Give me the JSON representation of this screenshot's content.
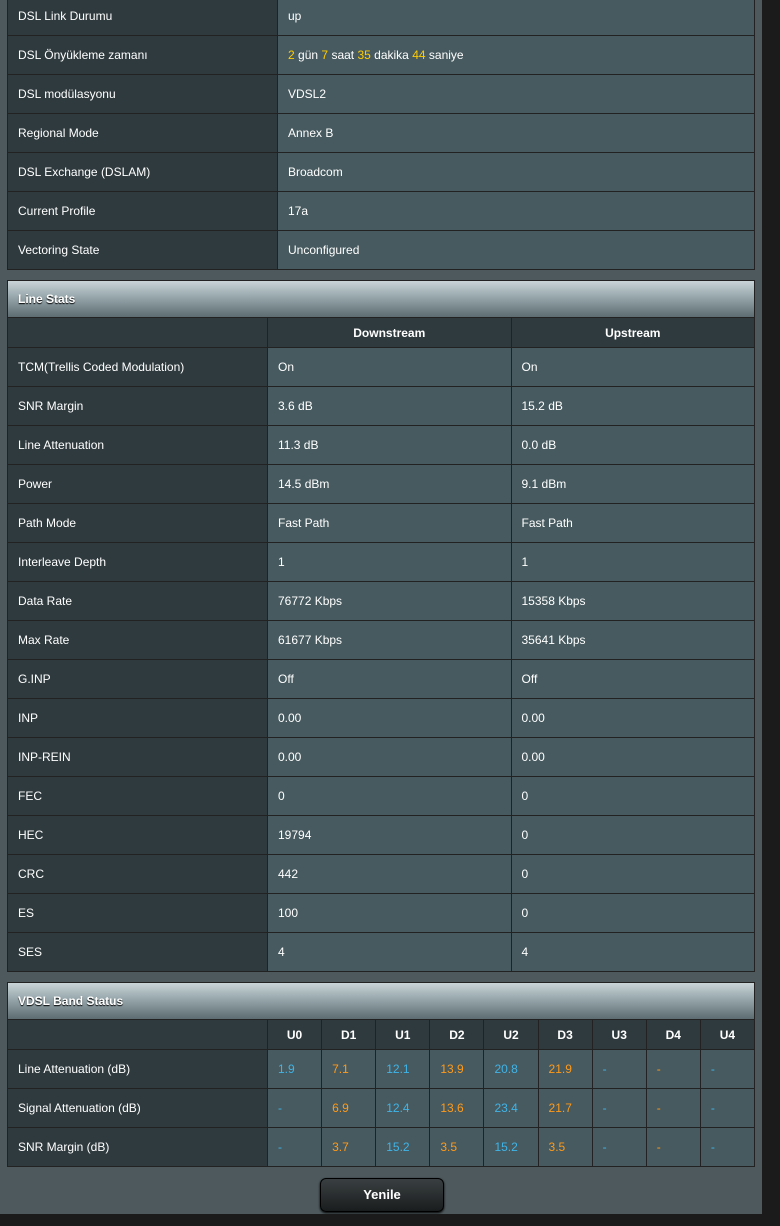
{
  "dsl_info": [
    {
      "label": "DSL Link Durumu",
      "value": "up"
    },
    {
      "label": "DSL Önyükleme zamanı",
      "uptime": {
        "days": "2",
        "days_unit": "gün",
        "hours": "7",
        "hours_unit": "saat",
        "minutes": "35",
        "minutes_unit": "dakika",
        "seconds": "44",
        "seconds_unit": "saniye"
      }
    },
    {
      "label": "DSL modülasyonu",
      "value": "VDSL2"
    },
    {
      "label": "Regional Mode",
      "value": "Annex B"
    },
    {
      "label": "DSL Exchange (DSLAM)",
      "value": "Broadcom"
    },
    {
      "label": "Current Profile",
      "value": "17a"
    },
    {
      "label": "Vectoring State",
      "value": "Unconfigured"
    }
  ],
  "line_stats": {
    "title": "Line Stats",
    "col_down": "Downstream",
    "col_up": "Upstream",
    "rows": [
      {
        "label": "TCM(Trellis Coded Modulation)",
        "down": "On",
        "up": "On"
      },
      {
        "label": "SNR Margin",
        "down": "3.6 dB",
        "up": "15.2 dB"
      },
      {
        "label": "Line Attenuation",
        "down": "11.3 dB",
        "up": "0.0 dB"
      },
      {
        "label": "Power",
        "down": "14.5 dBm",
        "up": "9.1 dBm"
      },
      {
        "label": "Path Mode",
        "down": "Fast Path",
        "up": "Fast Path"
      },
      {
        "label": "Interleave Depth",
        "down": "1",
        "up": "1"
      },
      {
        "label": "Data Rate",
        "down": "76772 Kbps",
        "up": "15358 Kbps"
      },
      {
        "label": "Max Rate",
        "down": "61677 Kbps",
        "up": "35641 Kbps"
      },
      {
        "label": "G.INP",
        "down": "Off",
        "up": "Off"
      },
      {
        "label": "INP",
        "down": "0.00",
        "up": "0.00"
      },
      {
        "label": "INP-REIN",
        "down": "0.00",
        "up": "0.00"
      },
      {
        "label": "FEC",
        "down": "0",
        "up": "0"
      },
      {
        "label": "HEC",
        "down": "19794",
        "up": "0"
      },
      {
        "label": "CRC",
        "down": "442",
        "up": "0"
      },
      {
        "label": "ES",
        "down": "100",
        "up": "0"
      },
      {
        "label": "SES",
        "down": "4",
        "up": "4"
      }
    ]
  },
  "band_status": {
    "title": "VDSL Band Status",
    "bands": [
      "U0",
      "D1",
      "U1",
      "D2",
      "U2",
      "D3",
      "U3",
      "D4",
      "U4"
    ],
    "rows": [
      {
        "label": "Line Attenuation (dB)",
        "values": [
          "1.9",
          "7.1",
          "12.1",
          "13.9",
          "20.8",
          "21.9",
          "-",
          "-",
          "-"
        ]
      },
      {
        "label": "Signal Attenuation (dB)",
        "values": [
          "-",
          "6.9",
          "12.4",
          "13.6",
          "23.4",
          "21.7",
          "-",
          "-",
          "-"
        ]
      },
      {
        "label": "SNR Margin (dB)",
        "values": [
          "-",
          "3.7",
          "15.2",
          "3.5",
          "15.2",
          "3.5",
          "-",
          "-",
          "-"
        ]
      }
    ],
    "upstream_color": "#3fb4e8",
    "downstream_color": "#ff9a1a"
  },
  "buttons": {
    "refresh": "Yenile"
  }
}
